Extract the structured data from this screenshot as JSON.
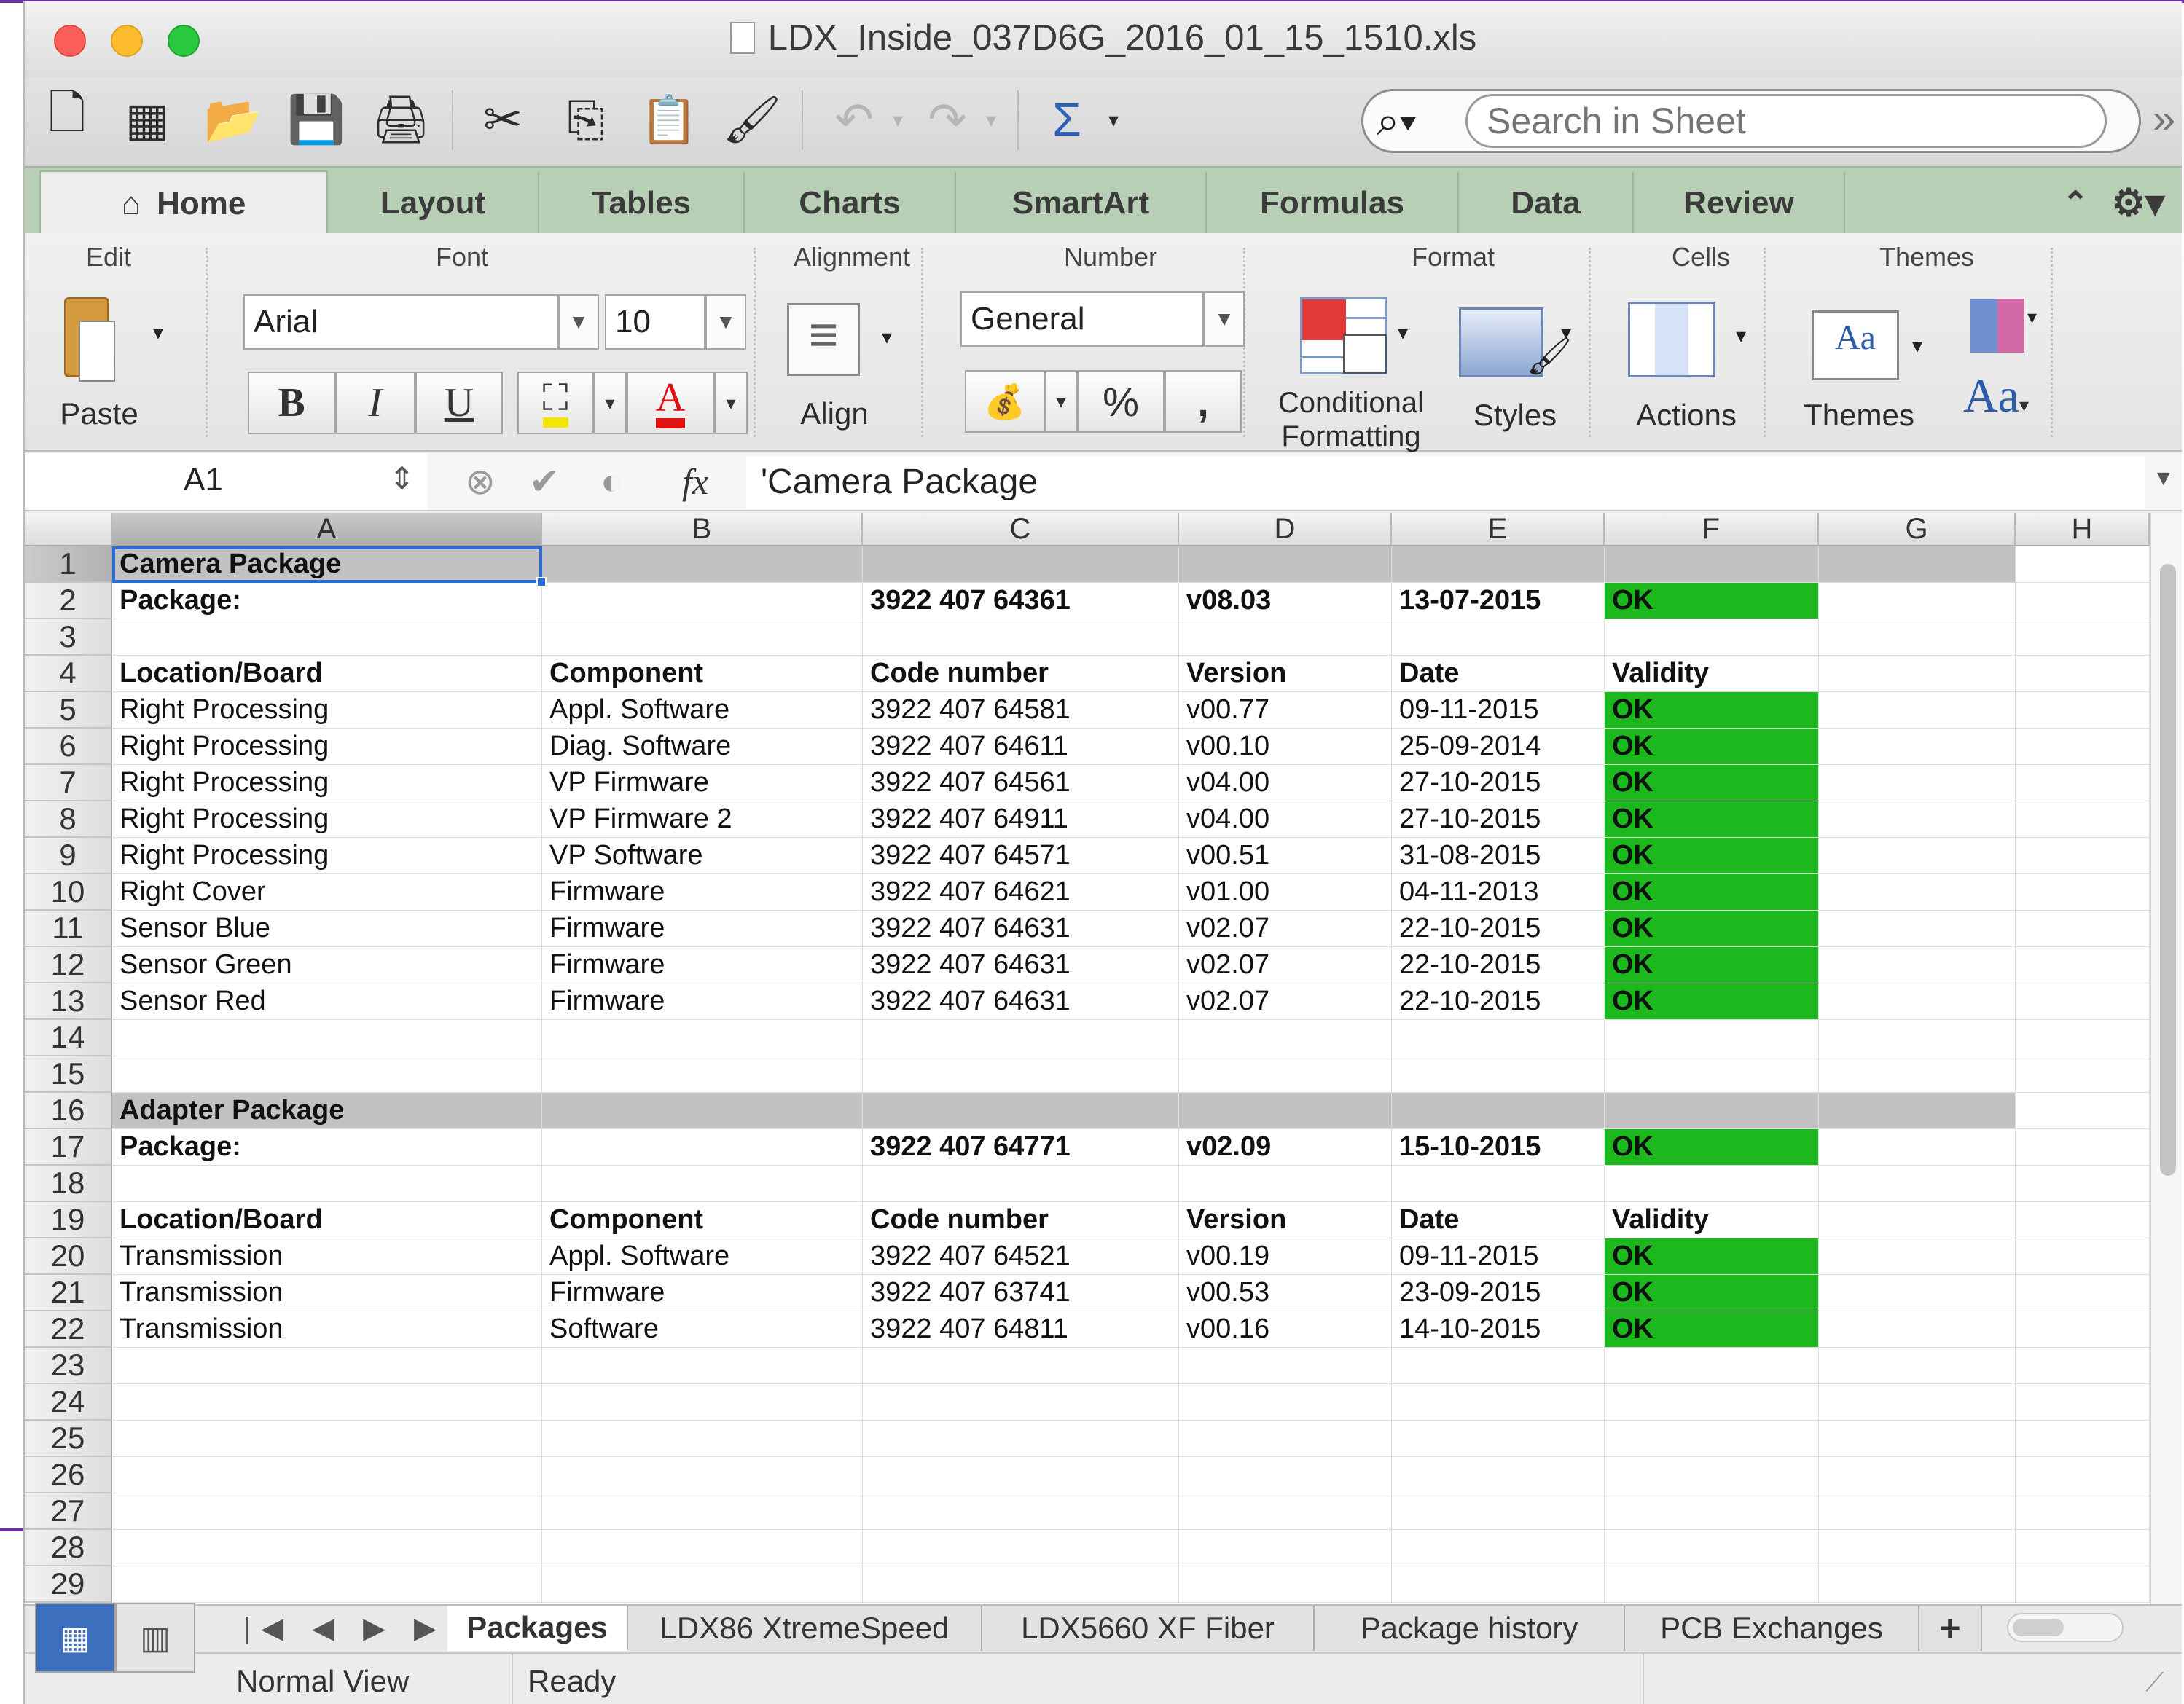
{
  "window": {
    "title": "LDX_Inside_037D6G_2016_01_15_1510.xls"
  },
  "toolbar": {
    "search_placeholder": "Search in Sheet",
    "undo_icon": "undo-icon",
    "sum_symbol": "Σ"
  },
  "tabs": [
    "Home",
    "Layout",
    "Tables",
    "Charts",
    "SmartArt",
    "Formulas",
    "Data",
    "Review"
  ],
  "ribbon": {
    "groups": {
      "edit": "Edit",
      "font": "Font",
      "alignment": "Alignment",
      "number": "Number",
      "format": "Format",
      "cells": "Cells",
      "themes": "Themes"
    },
    "paste": "Paste",
    "font_name": "Arial",
    "font_size": "10",
    "bold": "B",
    "italic": "I",
    "underline": "U",
    "font_color_glyph": "A",
    "align": "Align",
    "number_format": "General",
    "percent": "%",
    "comma": ",",
    "conditional_1": "Conditional",
    "conditional_2": "Formatting",
    "styles": "Styles",
    "actions": "Actions",
    "themes": "Themes",
    "themes_text_glyph": "Aa",
    "themes_preview_glyph": "Aa"
  },
  "formula_bar": {
    "name_box": "A1",
    "fx": "fx",
    "content": "'Camera Package"
  },
  "grid": {
    "columns": [
      "A",
      "B",
      "C",
      "D",
      "E",
      "F",
      "G",
      "H"
    ],
    "rows": [
      "1",
      "2",
      "3",
      "4",
      "5",
      "6",
      "7",
      "8",
      "9",
      "10",
      "11",
      "12",
      "13",
      "14",
      "15",
      "16",
      "17",
      "18",
      "19",
      "20",
      "21",
      "22",
      "23",
      "24",
      "25",
      "26",
      "27",
      "28",
      "29"
    ],
    "camera_title": "Camera Package",
    "camera_package": {
      "label": "Package:",
      "code": "3922 407 64361",
      "version": "v08.03",
      "date": "13-07-2015",
      "validity": "OK"
    },
    "headers": {
      "location": "Location/Board",
      "component": "Component",
      "code": "Code number",
      "version": "Version",
      "date": "Date",
      "validity": "Validity"
    },
    "camera_rows": [
      [
        "Right Processing",
        "Appl. Software",
        "3922 407 64581",
        "v00.77",
        "09-11-2015",
        "OK"
      ],
      [
        "Right Processing",
        "Diag. Software",
        "3922 407 64611",
        "v00.10",
        "25-09-2014",
        "OK"
      ],
      [
        "Right Processing",
        "VP Firmware",
        "3922 407 64561",
        "v04.00",
        "27-10-2015",
        "OK"
      ],
      [
        "Right Processing",
        "VP Firmware 2",
        "3922 407 64911",
        "v04.00",
        "27-10-2015",
        "OK"
      ],
      [
        "Right Processing",
        "VP Software",
        "3922 407 64571",
        "v00.51",
        "31-08-2015",
        "OK"
      ],
      [
        "Right Cover",
        "Firmware",
        "3922 407 64621",
        "v01.00",
        "04-11-2013",
        "OK"
      ],
      [
        "Sensor Blue",
        "Firmware",
        "3922 407 64631",
        "v02.07",
        "22-10-2015",
        "OK"
      ],
      [
        "Sensor Green",
        "Firmware",
        "3922 407 64631",
        "v02.07",
        "22-10-2015",
        "OK"
      ],
      [
        "Sensor Red",
        "Firmware",
        "3922 407 64631",
        "v02.07",
        "22-10-2015",
        "OK"
      ]
    ],
    "adapter_title": "Adapter Package",
    "adapter_package": {
      "label": "Package:",
      "code": "3922 407 64771",
      "version": "v02.09",
      "date": "15-10-2015",
      "validity": "OK"
    },
    "adapter_rows": [
      [
        "Transmission",
        "Appl. Software",
        "3922 407 64521",
        "v00.19",
        "09-11-2015",
        "OK"
      ],
      [
        "Transmission",
        "Firmware",
        "3922 407 63741",
        "v00.53",
        "23-09-2015",
        "OK"
      ],
      [
        "Transmission",
        "Software",
        "3922 407 64811",
        "v00.16",
        "14-10-2015",
        "OK"
      ]
    ]
  },
  "sheets": [
    "Packages",
    "LDX86 XtremeSpeed",
    "LDX5660 XF Fiber",
    "Package history",
    "PCB Exchanges"
  ],
  "sheet_add": "+",
  "status": {
    "view": "Normal View",
    "state": "Ready"
  },
  "colors": {
    "ok_green": "#1db81d",
    "section_gray": "#c2c2c2",
    "tab_green": "#b7cfb5",
    "selection_blue": "#2a6bd6"
  }
}
